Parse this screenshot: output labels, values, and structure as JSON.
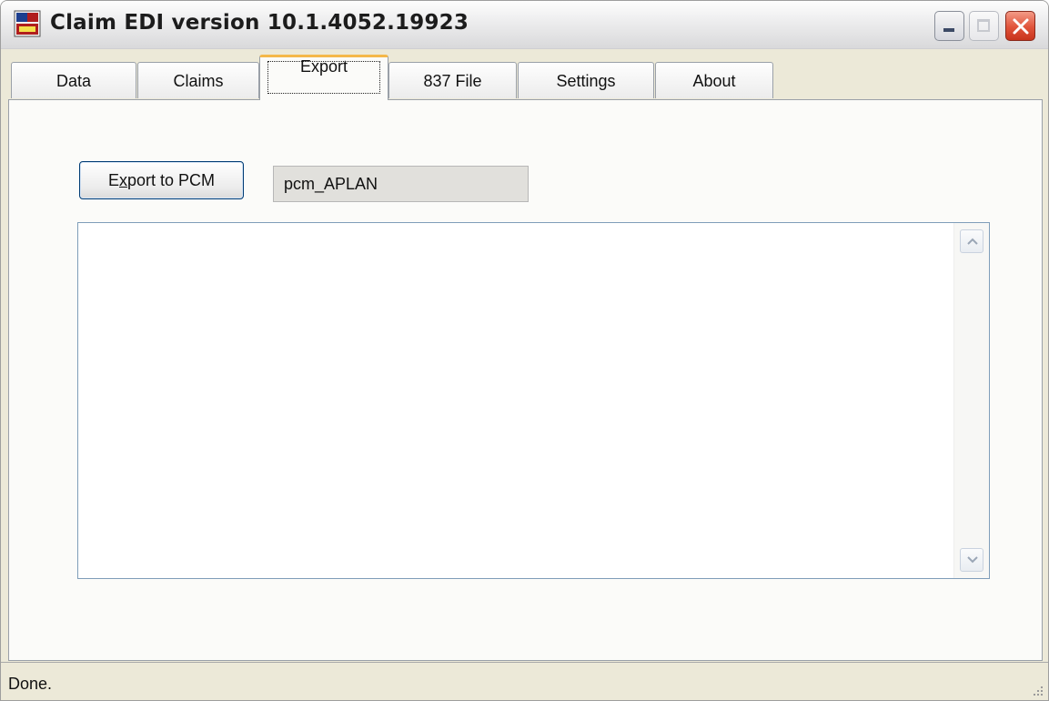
{
  "window": {
    "title": "Claim EDI version 10.1.4052.19923",
    "icon": "abc-edi-app-icon"
  },
  "titlebar_buttons": {
    "minimize": "minimize-icon",
    "maximize": "maximize-icon",
    "close": "close-icon"
  },
  "tabs": [
    {
      "label": "Data",
      "active": false
    },
    {
      "label": "Claims",
      "active": false
    },
    {
      "label": "Export",
      "active": true
    },
    {
      "label": "837 File",
      "active": false
    },
    {
      "label": "Settings",
      "active": false
    },
    {
      "label": "About",
      "active": false
    }
  ],
  "export_panel": {
    "export_button_label": "Export to PCM",
    "export_button_mnemonic": "x",
    "target_name_value": "pcm_APLAN",
    "output_text": ""
  },
  "status": {
    "text": "Done."
  },
  "colors": {
    "active_tab_accent": "#f4b84a",
    "close_button": "#e0533a",
    "input_readonly_bg": "#e1e0dc"
  }
}
